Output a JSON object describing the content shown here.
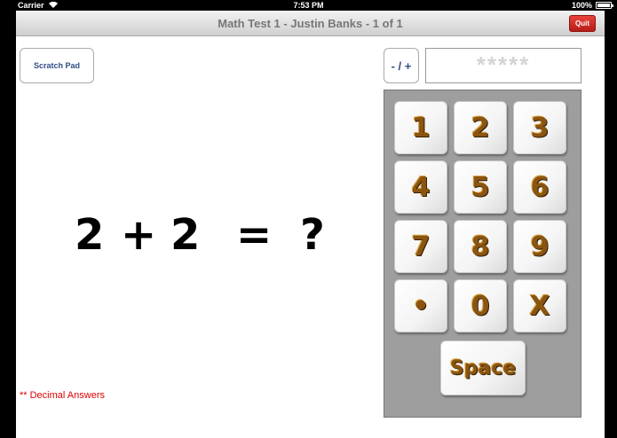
{
  "status_bar": {
    "carrier": "Carrier",
    "wifi_icon": "wifi-icon",
    "time": "7:53 PM",
    "battery_pct": "100%",
    "battery_icon": "battery-icon",
    "battery_level": 1.0
  },
  "header": {
    "title": "Math Test 1  -  Justin Banks  -  1 of 1",
    "quit_label": "Quit",
    "quit_color": "#d42a22"
  },
  "scratch_pad_label": "Scratch Pad",
  "equation": {
    "operand_a": "2",
    "operator": "+",
    "operand_b": "2",
    "equals": "=",
    "unknown": "?"
  },
  "decimal_note": "** Decimal Answers",
  "sign_toggle_label": "- / +",
  "answer_display": "*****",
  "keypad": {
    "keys": [
      "1",
      "2",
      "3",
      "4",
      "5",
      "6",
      "7",
      "8",
      "9",
      "•",
      "0",
      "X"
    ],
    "space_label": "Space",
    "key_color": "#8a5510"
  }
}
